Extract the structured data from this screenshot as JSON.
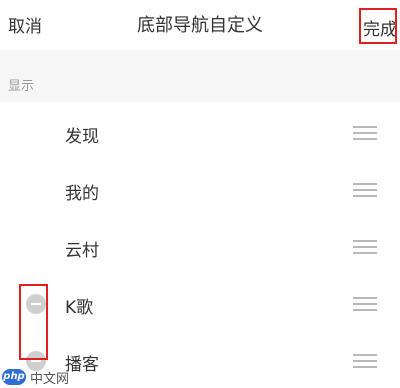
{
  "header": {
    "cancel_label": "取消",
    "title": "底部导航自定义",
    "done_label": "完成"
  },
  "section": {
    "label": "显示"
  },
  "items": [
    {
      "label": "发现",
      "removable": false
    },
    {
      "label": "我的",
      "removable": false
    },
    {
      "label": "云村",
      "removable": false
    },
    {
      "label": "K歌",
      "removable": true
    },
    {
      "label": "播客",
      "removable": true
    }
  ],
  "watermark": {
    "logo": "php",
    "text": "中文网"
  },
  "colors": {
    "highlight": "#e02020",
    "remove_button": "#cfcfcf",
    "section_bg": "#f6f6f6",
    "text": "#333333"
  },
  "icons": {
    "remove": "minus-circle-icon",
    "drag": "drag-handle-icon"
  }
}
